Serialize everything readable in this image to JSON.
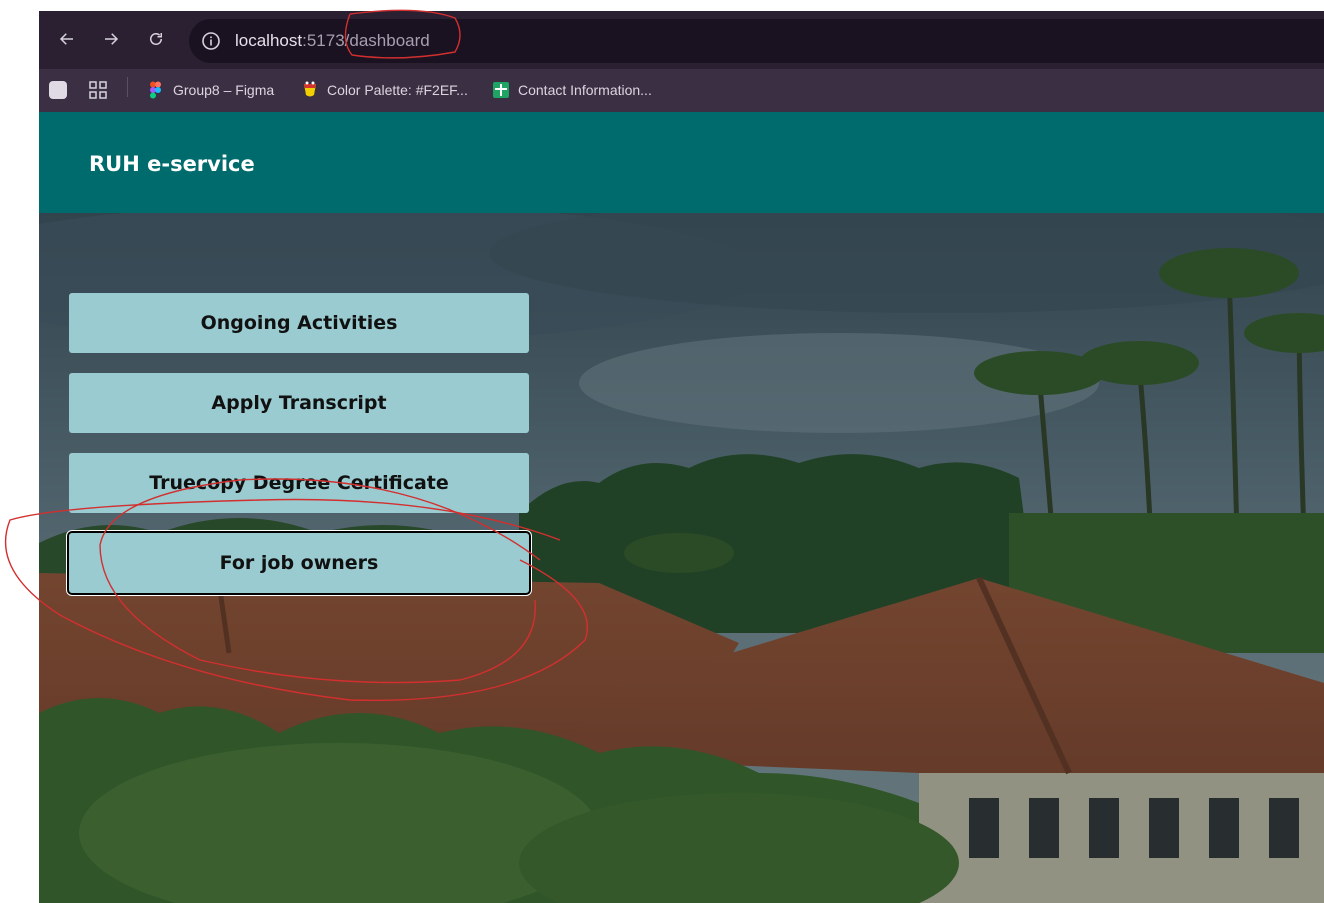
{
  "browser": {
    "url_host": "localhost",
    "url_rest": ":5173/dashboard",
    "bookmarks": [
      {
        "label": "Group8 – Figma",
        "icon": "figma-icon"
      },
      {
        "label": "Color Palette: #F2EF...",
        "icon": "palette-icon"
      },
      {
        "label": "Contact Information...",
        "icon": "sheets-icon"
      }
    ]
  },
  "app": {
    "title": "RUH e-service",
    "menu": [
      {
        "label": "Ongoing Activities"
      },
      {
        "label": "Apply Transcript"
      },
      {
        "label": "Truecopy Degree Certificate"
      },
      {
        "label": "For job owners"
      }
    ]
  },
  "colors": {
    "header": "#006b6c",
    "button": "#99cbd0",
    "annotation": "#d32f2f"
  }
}
